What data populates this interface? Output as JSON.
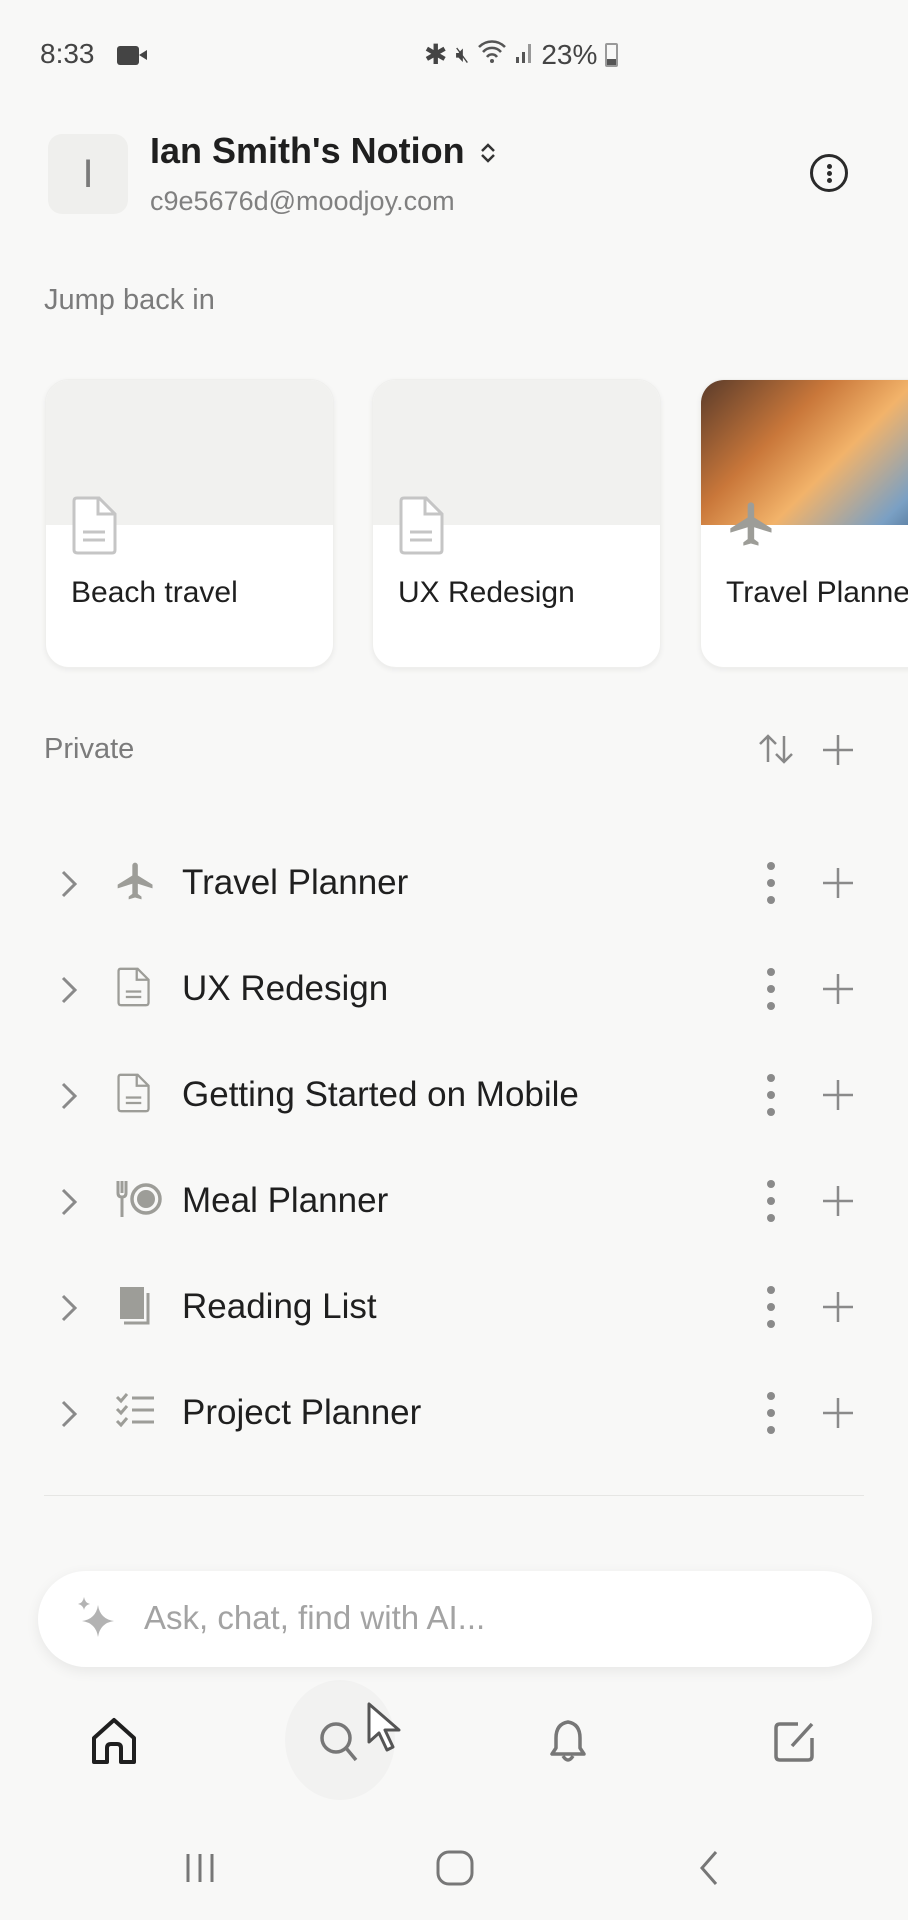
{
  "status_bar": {
    "time": "8:33",
    "battery_percent": "23%",
    "icons": [
      "video-record-icon",
      "bluetooth-icon",
      "mute-icon",
      "wifi-icon",
      "signal-icon",
      "battery-icon"
    ]
  },
  "workspace": {
    "avatar_letter": "I",
    "name": "Ian Smith's Notion",
    "email": "c9e5676d@moodjoy.com"
  },
  "jump_back_in": {
    "label": "Jump back in",
    "cards": [
      {
        "title": "Beach travel",
        "icon": "page-icon",
        "cover": "none"
      },
      {
        "title": "UX Redesign",
        "icon": "page-icon",
        "cover": "none"
      },
      {
        "title": "Travel Planner",
        "icon": "airplane-icon",
        "cover": "photo"
      }
    ]
  },
  "private": {
    "label": "Private",
    "items": [
      {
        "label": "Travel Planner",
        "icon": "airplane-icon"
      },
      {
        "label": "UX Redesign",
        "icon": "page-icon"
      },
      {
        "label": "Getting Started on Mobile",
        "icon": "page-icon"
      },
      {
        "label": "Meal Planner",
        "icon": "fork-plate-icon"
      },
      {
        "label": "Reading List",
        "icon": "book-icon"
      },
      {
        "label": "Project Planner",
        "icon": "checklist-icon"
      }
    ]
  },
  "ai_bar": {
    "placeholder": "Ask, chat, find with AI..."
  },
  "bottom_nav": [
    "home",
    "search",
    "inbox",
    "new-page"
  ]
}
